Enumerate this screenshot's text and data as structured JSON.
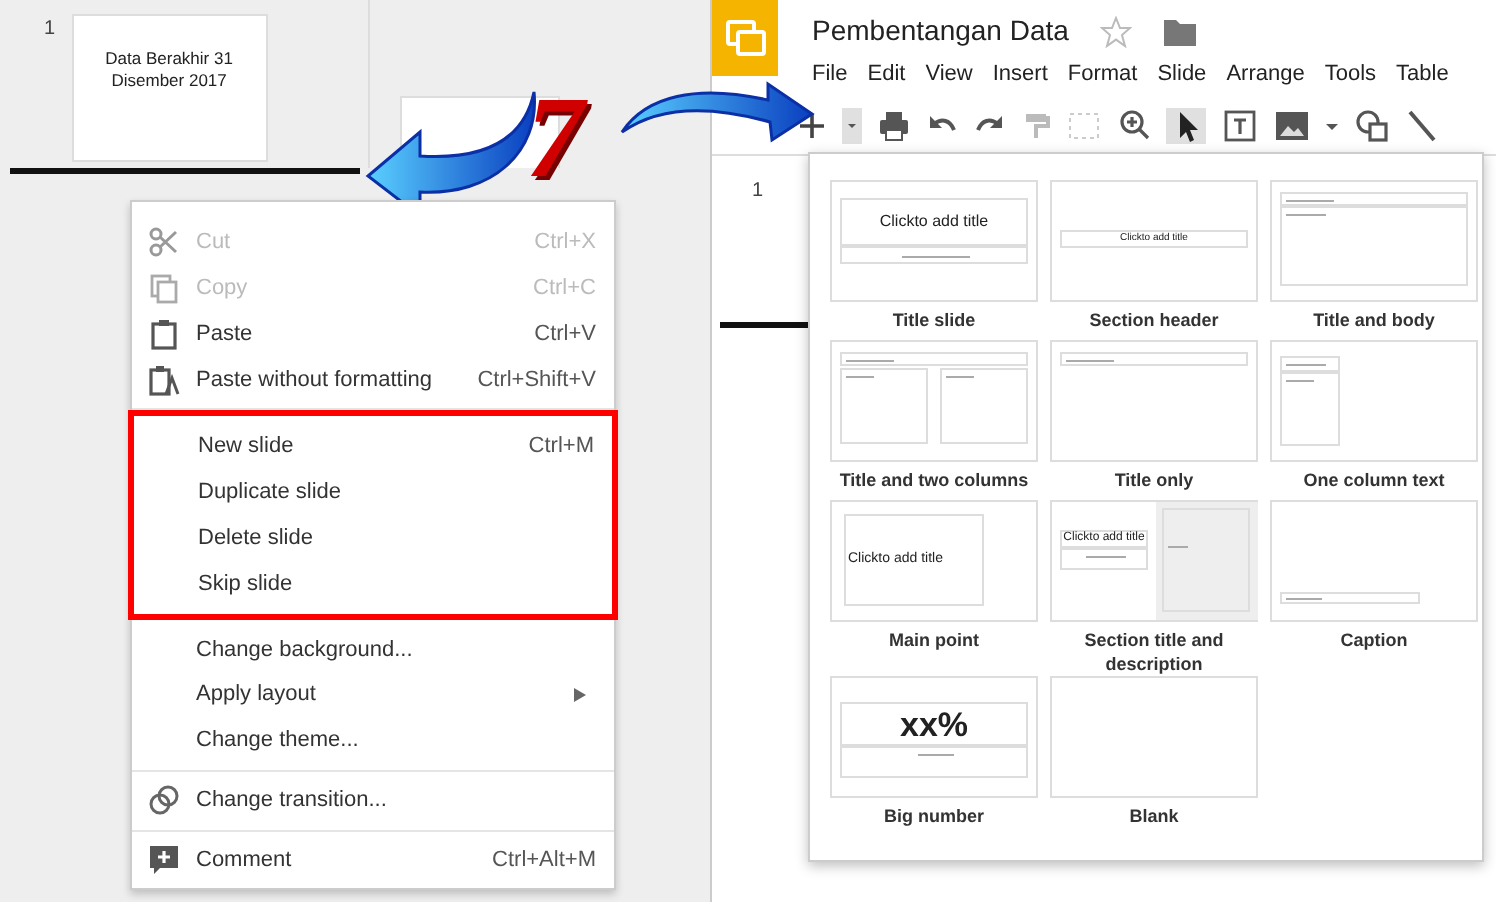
{
  "slide_panel": {
    "slides": [
      {
        "number": "1",
        "text": "Data Berakhir 31 Disember 2017"
      }
    ]
  },
  "step_number": "7",
  "context_menu": {
    "groups": [
      {
        "highlighted": false,
        "items": [
          {
            "label": "Cut",
            "shortcut": "Ctrl+X",
            "disabled": true,
            "kind": "cut"
          },
          {
            "label": "Copy",
            "shortcut": "Ctrl+C",
            "disabled": true,
            "kind": "copy"
          },
          {
            "label": "Paste",
            "shortcut": "Ctrl+V",
            "disabled": false,
            "kind": "paste"
          },
          {
            "label": "Paste without formatting",
            "shortcut": "Ctrl+Shift+V",
            "disabled": false,
            "kind": "paste-plain"
          }
        ]
      },
      {
        "highlighted": true,
        "items": [
          {
            "label": "New slide",
            "shortcut": "Ctrl+M",
            "disabled": false
          },
          {
            "label": "Duplicate slide",
            "disabled": false
          },
          {
            "label": "Delete slide",
            "disabled": false
          },
          {
            "label": "Skip slide",
            "disabled": false
          }
        ]
      },
      {
        "highlighted": false,
        "items": [
          {
            "label": "Change background...",
            "disabled": false
          },
          {
            "label": "Apply layout",
            "disabled": false,
            "submenu": true
          },
          {
            "label": "Change theme...",
            "disabled": false
          }
        ]
      },
      {
        "highlighted": false,
        "items": [
          {
            "label": "Change transition...",
            "disabled": false,
            "kind": "transition"
          }
        ]
      },
      {
        "highlighted": false,
        "items": [
          {
            "label": "Comment",
            "shortcut": "Ctrl+Alt+M",
            "disabled": false,
            "kind": "comment"
          }
        ]
      }
    ]
  },
  "app": {
    "title": "Pembentangan Data",
    "menu": [
      "File",
      "Edit",
      "View",
      "Insert",
      "Format",
      "Slide",
      "Arrange",
      "Tools",
      "Table"
    ],
    "slide_number": "1",
    "layouts": [
      {
        "label": "Title slide",
        "kind": "title-slide",
        "title_text": "Clickto add title"
      },
      {
        "label": "Section header",
        "kind": "section-header",
        "title_text": "Clickto add title"
      },
      {
        "label": "Title and body",
        "kind": "title-body"
      },
      {
        "label": "Title and two columns",
        "kind": "two-columns"
      },
      {
        "label": "Title only",
        "kind": "title-only"
      },
      {
        "label": "One column text",
        "kind": "one-column"
      },
      {
        "label": "Main point",
        "kind": "main-point",
        "title_text": "Clickto add title"
      },
      {
        "label": "Section title and description",
        "kind": "section-description",
        "title_text": "Clickto add title"
      },
      {
        "label": "Caption",
        "kind": "caption"
      },
      {
        "label": "Big number",
        "kind": "big-number",
        "title_text": "xx%"
      },
      {
        "label": "Blank",
        "kind": "blank"
      }
    ]
  }
}
